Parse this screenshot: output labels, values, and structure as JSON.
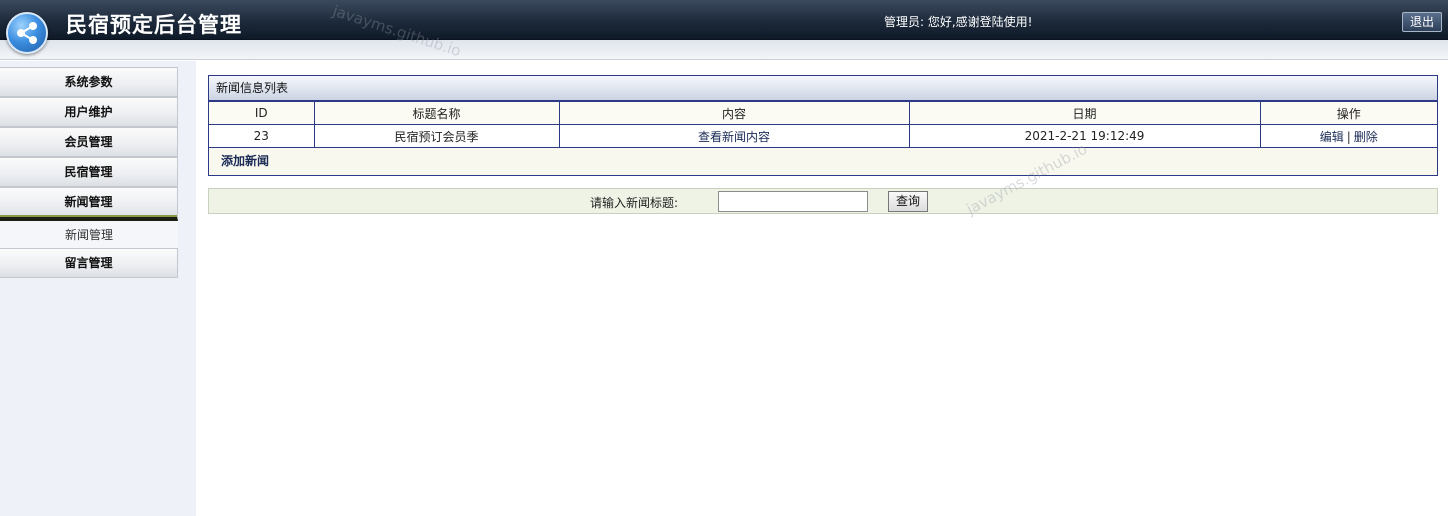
{
  "header": {
    "title": "民宿预定后台管理",
    "welcome": "管理员: 您好,感谢登陆使用!",
    "logout_label": "退出",
    "logo_icon": "share-network-icon"
  },
  "sidebar": {
    "items": [
      {
        "label": "系统参数"
      },
      {
        "label": "用户维护"
      },
      {
        "label": "会员管理"
      },
      {
        "label": "民宿管理"
      },
      {
        "label": "新闻管理",
        "active": true
      },
      {
        "label": "新闻管理",
        "sub": true
      },
      {
        "label": "留言管理"
      }
    ]
  },
  "news_panel": {
    "title": "新闻信息列表",
    "columns": [
      "ID",
      "标题名称",
      "内容",
      "日期",
      "操作"
    ],
    "rows": [
      {
        "id": "23",
        "title": "民宿预订会员季",
        "content": "查看新闻内容",
        "date": "2021-2-21 19:12:49",
        "edit": "编辑",
        "separator": "|",
        "delete": "删除"
      }
    ],
    "add_label": "添加新闻"
  },
  "search": {
    "label": "请输入新闻标题:",
    "value": "",
    "button_label": "查询"
  },
  "watermarks": [
    "javayms.github.io",
    "javayms.github.io"
  ]
}
